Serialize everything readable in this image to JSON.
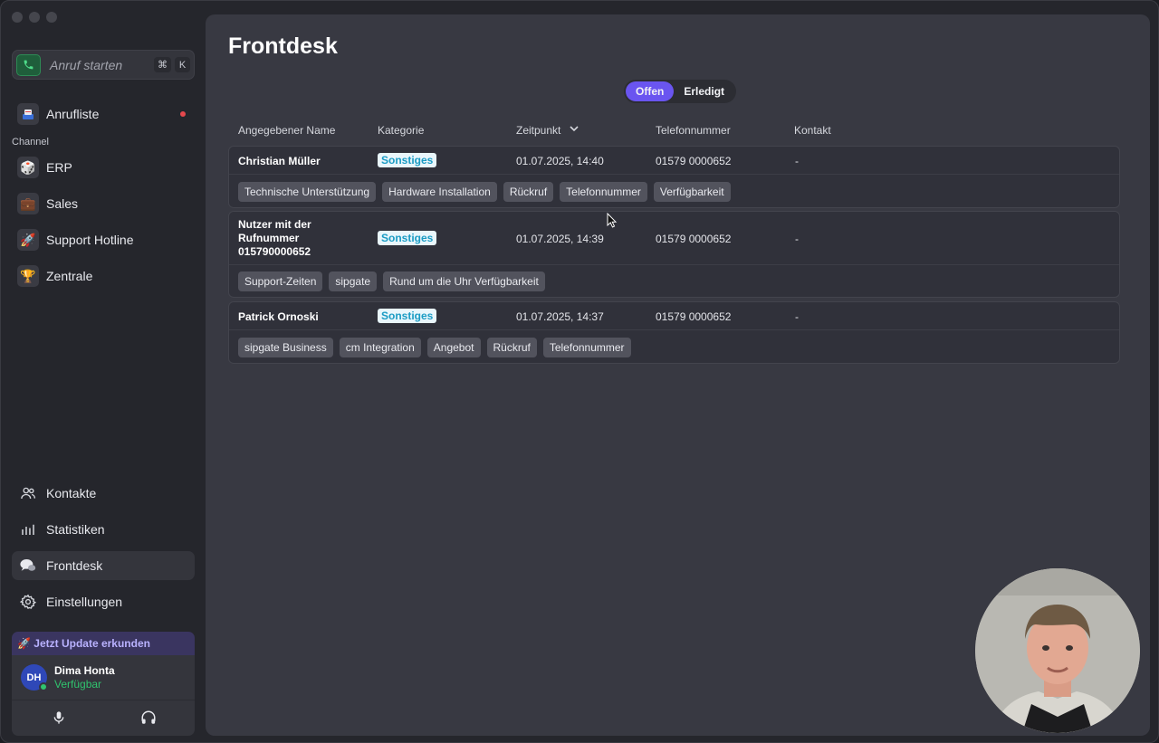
{
  "sidebar": {
    "call": {
      "label": "Anruf starten",
      "shortcut_cmd": "⌘",
      "shortcut_key": "K"
    },
    "anrufliste": {
      "label": "Anrufliste",
      "icon": "inbox-icon"
    },
    "channel_label": "Channel",
    "channels": [
      {
        "label": "ERP",
        "emoji": "🎲"
      },
      {
        "label": "Sales",
        "emoji": "💼"
      },
      {
        "label": "Support Hotline",
        "emoji": "🚀"
      },
      {
        "label": "Zentrale",
        "emoji": "🏆"
      }
    ],
    "bottom_nav": [
      {
        "label": "Kontakte",
        "icon": "contacts-icon"
      },
      {
        "label": "Statistiken",
        "icon": "bar-chart-icon"
      },
      {
        "label": "Frontdesk",
        "icon": "chat-bubbles-icon",
        "active": true
      },
      {
        "label": "Einstellungen",
        "icon": "gear-icon"
      }
    ],
    "update_banner": "🚀 Jetzt Update erkunden",
    "user": {
      "initials": "DH",
      "name": "Dima Honta",
      "status": "Verfügbar"
    }
  },
  "main": {
    "title": "Frontdesk",
    "segments": [
      {
        "label": "Offen",
        "active": true
      },
      {
        "label": "Erledigt",
        "active": false
      }
    ],
    "columns": {
      "name": "Angegebener Name",
      "category": "Kategorie",
      "time": "Zeitpunkt",
      "phone": "Telefonnummer",
      "contact": "Kontakt"
    },
    "rows": [
      {
        "name": "Christian Müller",
        "category": "Sonstiges",
        "time": "01.07.2025, 14:40",
        "phone": "01579 0000652",
        "contact": "-",
        "tags": [
          "Technische Unterstützung",
          "Hardware Installation",
          "Rückruf",
          "Telefonnummer",
          "Verfügbarkeit"
        ]
      },
      {
        "name_lines": [
          "Nutzer mit der",
          "Rufnummer",
          "015790000652"
        ],
        "category": "Sonstiges",
        "time": "01.07.2025, 14:39",
        "phone": "01579 0000652",
        "contact": "-",
        "tags": [
          "Support-Zeiten",
          "sipgate",
          "Rund um die Uhr Verfügbarkeit"
        ]
      },
      {
        "name": "Patrick Ornoski",
        "category": "Sonstiges",
        "time": "01.07.2025, 14:37",
        "phone": "01579 0000652",
        "contact": "-",
        "tags": [
          "sipgate Business",
          "cm Integration",
          "Angebot",
          "Rückruf",
          "Telefonnummer"
        ]
      }
    ]
  },
  "colors": {
    "accent": "#6a55f0",
    "badge_text": "#1b9cc4",
    "status_green": "#30c46e",
    "notification_red": "#e5484d"
  }
}
